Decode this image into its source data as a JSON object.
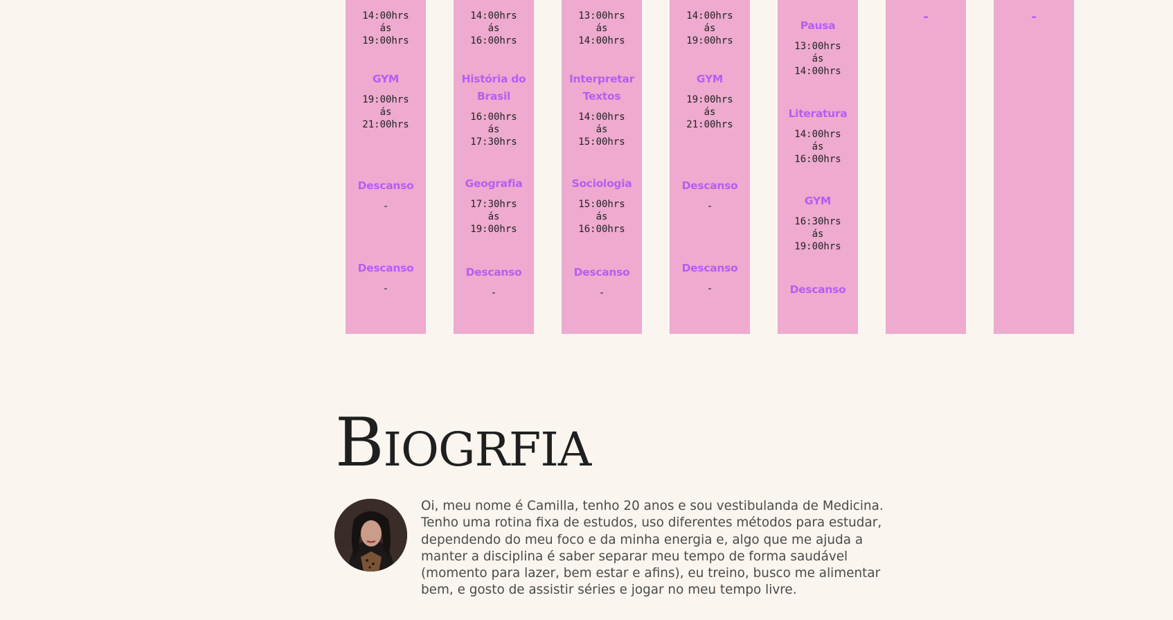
{
  "schedule": {
    "columns": [
      {
        "entries": [
          {
            "time": "14:00hrs\nás\n19:00hrs"
          },
          {
            "subject": "GYM",
            "time": "19:00hrs\nás\n21:00hrs"
          },
          {
            "subject": "Descanso",
            "time": "-"
          },
          {
            "subject": "Descanso",
            "time": "-"
          }
        ]
      },
      {
        "entries": [
          {
            "time": "14:00hrs\nás\n16:00hrs"
          },
          {
            "subject": "História do Brasil",
            "time": "16:00hrs\nás\n17:30hrs"
          },
          {
            "subject": "Geografia",
            "time": "17:30hrs\nás\n19:00hrs"
          },
          {
            "subject": "Descanso",
            "time": "-"
          }
        ]
      },
      {
        "entries": [
          {
            "time": "13:00hrs\nás\n14:00hrs"
          },
          {
            "subject": "Interpretar Textos",
            "time": "14:00hrs\nás\n15:00hrs"
          },
          {
            "subject": "Sociologia",
            "time": "15:00hrs\nás\n16:00hrs"
          },
          {
            "subject": "Descanso",
            "time": "-"
          }
        ]
      },
      {
        "entries": [
          {
            "time": "14:00hrs\nás\n19:00hrs"
          },
          {
            "subject": "GYM",
            "time": "19:00hrs\nás\n21:00hrs"
          },
          {
            "subject": "Descanso",
            "time": "-"
          },
          {
            "subject": "Descanso",
            "time": "-"
          }
        ]
      },
      {
        "entries": [
          {
            "subject": "Pausa",
            "time": "13:00hrs\nás\n14:00hrs"
          },
          {
            "subject": "Literatura",
            "time": "14:00hrs\nás\n16:00hrs"
          },
          {
            "subject": "GYM",
            "time": "16:30hrs\nás\n19:00hrs"
          },
          {
            "subject": "Descanso"
          }
        ]
      },
      {
        "entries": [
          {
            "subject": "-"
          }
        ]
      },
      {
        "entries": [
          {
            "subject": "-"
          }
        ]
      }
    ]
  },
  "biography": {
    "title": "Biogrfia",
    "text": "Oi, meu nome é Camilla, tenho 20 anos e sou vestibulanda de Medicina. Tenho uma rotina fixa de estudos, uso diferentes métodos para estudar, dependendo do meu foco e da minha energia e, algo que me ajuda a manter a disciplina é saber separar meu tempo de forma saudável (momento para lazer, bem estar e afins), eu treino, busco me alimentar bem, e gosto de assistir séries e jogar no meu tempo livre."
  },
  "colors": {
    "background": "#faf5ee",
    "column": "#eeaacf",
    "subject": "#b45ff0",
    "text": "#222222"
  }
}
